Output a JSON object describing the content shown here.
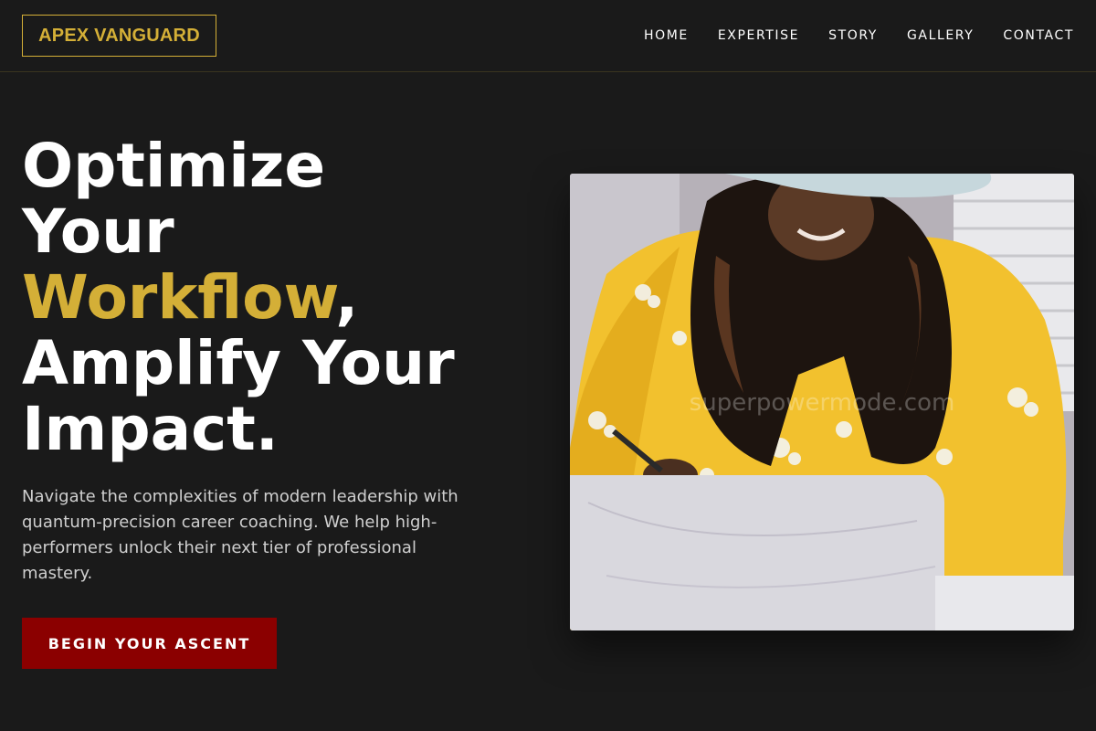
{
  "brand": {
    "name": "APEX VANGUARD"
  },
  "nav": {
    "items": [
      {
        "label": "HOME"
      },
      {
        "label": "EXPERTISE"
      },
      {
        "label": "STORY"
      },
      {
        "label": "GALLERY"
      },
      {
        "label": "CONTACT"
      }
    ]
  },
  "hero": {
    "headline": {
      "line1": "Optimize",
      "line2": "Your",
      "accent": "Workflow",
      "accent_suffix": ",",
      "line4": "Amplify Your",
      "line5": "Impact."
    },
    "description": "Navigate the complexities of modern leadership with quantum-precision career coaching. We help high-performers unlock their next tier of professional mastery.",
    "cta_label": "BEGIN YOUR ASCENT",
    "image": {
      "subject": "woman in yellow floral blouse writing with pen",
      "watermark": "superpowermode.com"
    }
  },
  "colors": {
    "background": "#1a1a1a",
    "accent_gold": "#d4af37",
    "cta_red": "#8b0000",
    "text_muted": "#cfcfcf"
  }
}
